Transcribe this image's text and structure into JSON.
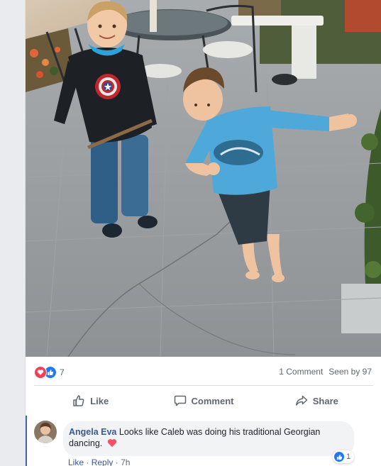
{
  "post": {
    "photo_alt_icon": "photo-of-two-boys-on-patio"
  },
  "reactions": {
    "types": [
      "love",
      "like"
    ],
    "count": "7",
    "comments_text": "1 Comment",
    "seen_text": "Seen by 97"
  },
  "actions": {
    "like": "Like",
    "comment": "Comment",
    "share": "Share"
  },
  "comment": {
    "author": "Angela Eva",
    "text": "Looks like Caleb was doing his traditional Georgian dancing.",
    "emoji": "heart",
    "reaction_count": "1",
    "like_label": "Like",
    "separator": "·",
    "reply_label": "Reply",
    "time": "7h"
  },
  "colors": {
    "facebook_blue": "#4267b2",
    "link_blue": "#385898",
    "love_red": "#f33e58",
    "like_blue": "#2078f4",
    "muted_text": "#606770"
  }
}
